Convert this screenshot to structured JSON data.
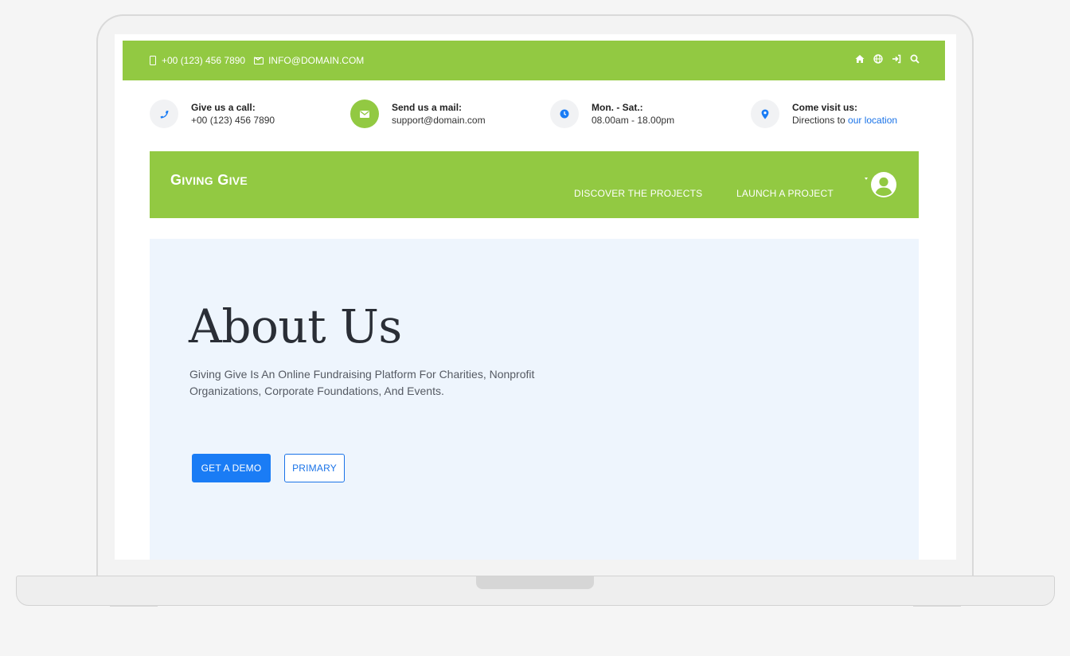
{
  "topbar": {
    "phone": "+00 (123) 456 7890",
    "email": "INFO@DOMAIN.COM",
    "icons": [
      "home-icon",
      "globe-icon",
      "sign-in-icon",
      "search-icon"
    ]
  },
  "info": [
    {
      "title": "Give us a call:",
      "sub": "+00 (123) 456 7890",
      "icon": "phone-icon"
    },
    {
      "title": "Send us a mail:",
      "sub": "support@domain.com",
      "icon": "envelope-icon"
    },
    {
      "title": "Mon. - Sat.:",
      "sub": "08.00am - 18.00pm",
      "icon": "clock-icon"
    },
    {
      "title": "Come visit us:",
      "sub_prefix": "Directions to ",
      "sub_link": "our location",
      "icon": "map-marker-icon"
    }
  ],
  "nav": {
    "brand_first_initial": "G",
    "brand_first_rest": "IVING",
    "brand_second_initial": "G",
    "brand_second_rest": "IVE",
    "links": [
      "DISCOVER THE PROJECTS",
      "LAUNCH A PROJECT"
    ]
  },
  "hero": {
    "title": "About Us",
    "description": "Giving Give Is An Online Fundraising Platform For Charities, Nonprofit Organizations, Corporate Foundations, And Events.",
    "demo_label": "GET A DEMO",
    "primary_label": "PRIMARY"
  },
  "colors": {
    "brand_green": "#92c942",
    "hero_bg": "#eef5fd",
    "accent_blue": "#1a7cf5"
  }
}
